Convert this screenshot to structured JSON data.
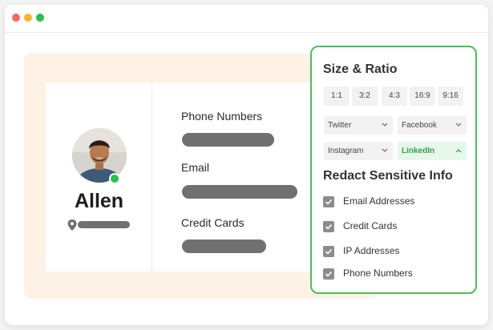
{
  "colors": {
    "accent": "#4cbe5a",
    "close_dot": "#f26a5b",
    "minimize_dot": "#f8b42f",
    "maximize_dot": "#27c048",
    "linkedin_active": "#2fa24d"
  },
  "profile": {
    "name": "Allen",
    "avatar_icon": "person-avatar-icon",
    "location_icon": "location-pin-icon"
  },
  "fields": {
    "phone_label": "Phone Numbers",
    "email_label": "Email",
    "credit_label": "Credit Cards"
  },
  "panel": {
    "size_title": "Size & Ratio",
    "ratios": [
      "1:1",
      "3:2",
      "4:3",
      "16:9",
      "9:16"
    ],
    "platforms": [
      {
        "label": "Twitter",
        "selected": false
      },
      {
        "label": "Facebook",
        "selected": false
      },
      {
        "label": "Instagram",
        "selected": false
      },
      {
        "label": "LinkedIn",
        "selected": true
      }
    ],
    "redact_title": "Redact Sensitive Info",
    "redact_items": [
      {
        "label": "Email Addresses",
        "checked": true
      },
      {
        "label": "Credit Cards",
        "checked": true
      },
      {
        "label": "IP Addresses",
        "checked": true
      },
      {
        "label": "Phone Numbers",
        "checked": true
      }
    ]
  }
}
